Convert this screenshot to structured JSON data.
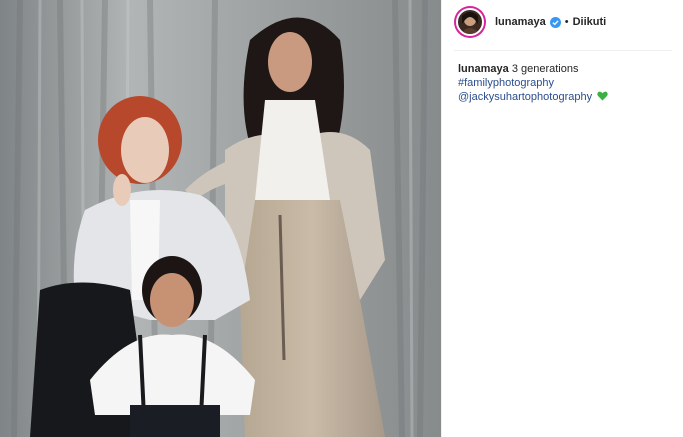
{
  "post": {
    "username": "lunamaya",
    "follow_status": "Diikuti",
    "separator": "•",
    "caption": {
      "author": "lunamaya",
      "text": "3 generations",
      "hashtag": "#familyphotography",
      "mention": "@jackysuhartophotography",
      "emoji": "green-heart-icon"
    }
  },
  "colors": {
    "verified": "#3897f0",
    "link": "#2b4e8e",
    "heart": "#3bb143",
    "avatar_ring": "#d6249f"
  }
}
